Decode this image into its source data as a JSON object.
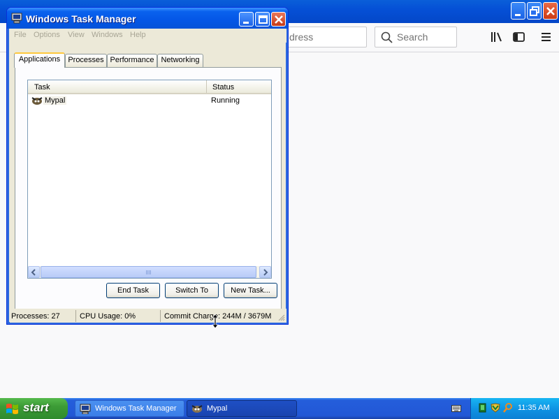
{
  "browser": {
    "address_placeholder": "dress",
    "search_placeholder": "Search"
  },
  "task_manager": {
    "title": "Windows Task Manager",
    "menu": [
      "File",
      "Options",
      "View",
      "Windows",
      "Help"
    ],
    "tabs": [
      "Applications",
      "Processes",
      "Performance",
      "Networking"
    ],
    "active_tab": "Applications",
    "columns": {
      "task": "Task",
      "status": "Status"
    },
    "rows": [
      {
        "task": "Mypal",
        "status": "Running"
      }
    ],
    "buttons": {
      "end_task": "End Task",
      "switch_to": "Switch To",
      "new_task": "New Task..."
    },
    "statusbar": {
      "processes": "Processes: 27",
      "cpu": "CPU Usage: 0%",
      "commit": "Commit Charge: 244M / 3679M"
    }
  },
  "taskbar": {
    "start_label": "start",
    "items": [
      {
        "label": "Windows Task Manager",
        "icon": "task-manager-icon",
        "active": false
      },
      {
        "label": "Mypal",
        "icon": "mypal-icon",
        "active": true
      }
    ],
    "clock": "11:35 AM"
  },
  "colors": {
    "titlebar_blue": "#0453d8",
    "taskbar_blue": "#245edb",
    "start_green": "#3c9b36",
    "window_face": "#ece9d8"
  }
}
